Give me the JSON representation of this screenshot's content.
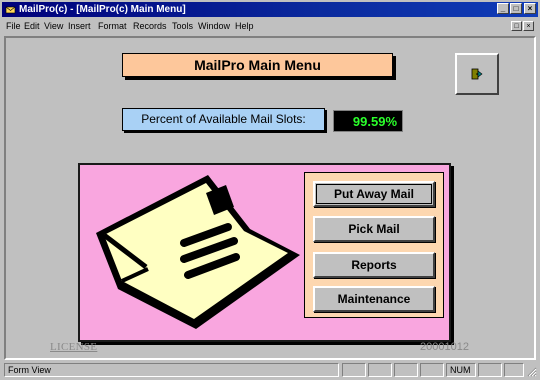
{
  "window": {
    "title": "MailPro(c) - [MailPro(c) Main Menu]",
    "controls": {
      "minimize": "_",
      "restore": "□",
      "close": "×"
    }
  },
  "menubar": {
    "items": [
      "File",
      "Edit",
      "View",
      "Insert",
      "Format",
      "Records",
      "Tools",
      "Window",
      "Help"
    ],
    "doc_controls": {
      "restore": "□",
      "close": "×"
    }
  },
  "form": {
    "title": "MailPro Main Menu",
    "exit_icon": "door-exit-icon",
    "percent_label": "Percent of Available Mail Slots:",
    "percent_value": "99.59%",
    "buttons": [
      {
        "label": "Put Away Mail"
      },
      {
        "label": "Pick Mail"
      },
      {
        "label": "Reports"
      },
      {
        "label": "Maintenance"
      }
    ],
    "license_link": "LICENSE",
    "version": "20001012"
  },
  "statusbar": {
    "mode": "Form View",
    "indicator": "NUM"
  },
  "colors": {
    "title_fill": "#fdc79b",
    "label_fill": "#a9d1f5",
    "panel_fill": "#f9a6df",
    "button_box_fill": "#fdd7b0",
    "value_text": "#2bff2b",
    "value_background": "#000000"
  }
}
